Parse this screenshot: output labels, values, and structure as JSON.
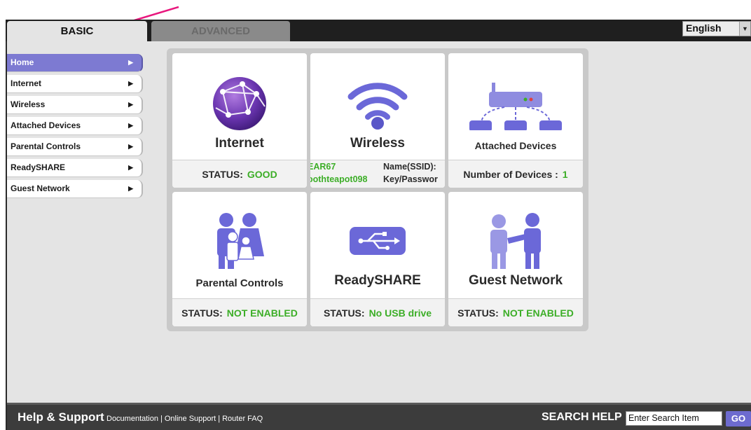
{
  "tabs": {
    "basic": "BASIC",
    "advanced": "ADVANCED"
  },
  "language": {
    "selected": "English"
  },
  "sidebar": {
    "items": [
      {
        "label": "Home",
        "active": true
      },
      {
        "label": "Internet"
      },
      {
        "label": "Wireless"
      },
      {
        "label": "Attached Devices"
      },
      {
        "label": "Parental Controls"
      },
      {
        "label": "ReadySHARE"
      },
      {
        "label": "Guest Network"
      }
    ]
  },
  "cards": {
    "internet": {
      "title": "Internet",
      "status_label": "STATUS:",
      "status_value": "GOOD",
      "icon": "globe-network-icon"
    },
    "wireless": {
      "title": "Wireless",
      "ssid_value": "EAR67",
      "ssid_label": "Name(SSID):",
      "key_value": "oothteapot098",
      "key_label": "Key/Passwor",
      "icon": "wifi-icon"
    },
    "attached": {
      "title": "Attached Devices",
      "count_label": "Number of Devices :",
      "count_value": "1",
      "icon": "router-devices-icon"
    },
    "parental": {
      "title": "Parental Controls",
      "status_label": "STATUS:",
      "status_value": "NOT ENABLED",
      "icon": "family-icon"
    },
    "readyshare": {
      "title": "ReadySHARE",
      "status_label": "STATUS:",
      "status_value": "No USB drive",
      "icon": "usb-icon"
    },
    "guest": {
      "title": "Guest Network",
      "status_label": "STATUS:",
      "status_value": "NOT ENABLED",
      "icon": "handshake-people-icon"
    }
  },
  "footer": {
    "title": "Help & Support",
    "links": [
      "Documentation",
      "Online Support",
      "Router FAQ"
    ],
    "search_label": "SEARCH HELP",
    "search_value": "Enter Search Item",
    "go_label": "GO"
  },
  "colors": {
    "accent": "#7d7ad2",
    "status_green": "#3cae27",
    "annotation_arrow": "#e8177d"
  }
}
